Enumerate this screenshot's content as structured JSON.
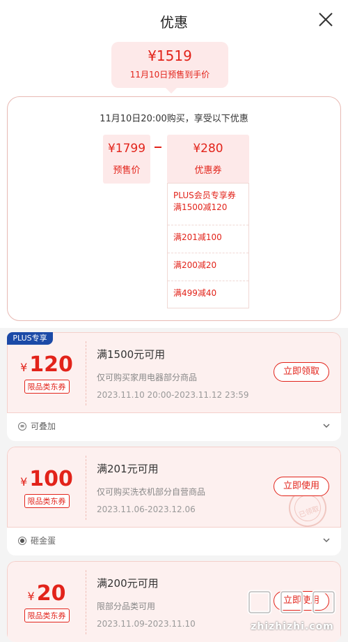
{
  "header": {
    "title": "优惠"
  },
  "summary": {
    "price": "¥1519",
    "caption": "11月10日预售到手价"
  },
  "detail": {
    "heading": "11月10日20:00购买，享受以下优惠",
    "presale": {
      "amount": "¥1799",
      "label": "预售价"
    },
    "operator": "-",
    "coupon": {
      "amount": "¥280",
      "label": "优惠券"
    },
    "coupon_items": [
      {
        "line1": "PLUS会员专享券",
        "line2": "满1500减120"
      },
      {
        "line1": "满201减100"
      },
      {
        "line1": "满200减20"
      },
      {
        "line1": "满499减40"
      }
    ]
  },
  "cards": [
    {
      "badge": "PLUS专享",
      "currency": "¥",
      "amount": "120",
      "tag": "限品类东券",
      "title": "满1500元可用",
      "desc": "仅可购买家用电器部分商品",
      "period": "2023.11.10 20:00-2023.11.12 23:59",
      "action": "立即领取",
      "footer": "可叠加",
      "footer_icon": "stack-icon"
    },
    {
      "currency": "¥",
      "amount": "100",
      "tag": "限品类东券",
      "title": "满201元可用",
      "desc": "仅可购买洗衣机部分自营商品",
      "period": "2023.11.06-2023.12.06",
      "action": "立即使用",
      "stamp": "已领取",
      "footer": "砸金蛋",
      "footer_icon": "egg-icon"
    },
    {
      "currency": "¥",
      "amount": "20",
      "tag": "限品类东券",
      "title": "满200元可用",
      "desc": "限部分品类可用",
      "period": "2023.11.09-2023.11.10",
      "action": "立即使用"
    }
  ],
  "watermark": {
    "text": "zhizhizhi.com"
  },
  "colors": {
    "accent": "#e2231a",
    "plus_badge": "#1b4aa7",
    "card_bg": "#fdf0ef"
  }
}
